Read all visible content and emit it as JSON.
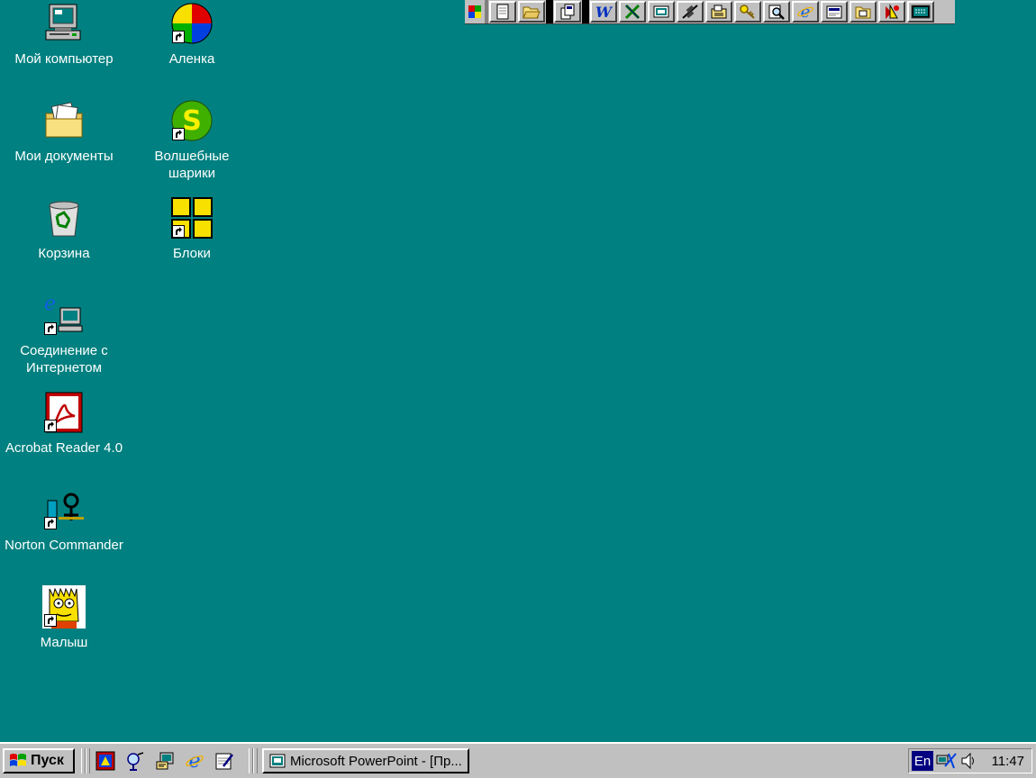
{
  "desktop": {
    "icons": [
      {
        "label": "Мой компьютер",
        "icon": "my-computer-icon"
      },
      {
        "label": "Мои документы",
        "icon": "my-documents-icon"
      },
      {
        "label": "Корзина",
        "icon": "recycle-bin-icon"
      },
      {
        "label": "Соединение с\nИнтернетом",
        "icon": "internet-connection-icon"
      },
      {
        "label": "Acrobat Reader 4.0",
        "icon": "acrobat-reader-icon"
      },
      {
        "label": "Norton Commander",
        "icon": "norton-commander-icon"
      },
      {
        "label": "Малыш",
        "icon": "malysh-icon"
      },
      {
        "label": "Аленка",
        "icon": "alenka-ball-icon"
      },
      {
        "label": "Волшебные\nшарики",
        "icon": "magic-balls-icon"
      },
      {
        "label": "Блоки",
        "icon": "blocks-icon"
      }
    ]
  },
  "office_toolbar": {
    "buttons": [
      "new-document-icon",
      "open-folder-icon",
      "binder-icon",
      "word-icon",
      "excel-icon",
      "powerpoint-icon",
      "satellite-icon",
      "contacts-icon",
      "key-icon",
      "find-icon",
      "internet-explorer-icon",
      "publisher-icon",
      "folder-icon",
      "access-icon",
      "keyboard-icon"
    ]
  },
  "taskbar": {
    "start_label": "Пуск",
    "quick_launch": [
      "powerpoint-ql-icon",
      "outlook-ql-icon",
      "desktop-ql-icon",
      "ie-ql-icon",
      "notepad-ql-icon"
    ],
    "task_label": "Microsoft PowerPoint - [Пр...",
    "tray": {
      "language": "En",
      "clock": "11:47"
    }
  },
  "colors": {
    "desktop": "#008080",
    "face": "#c0c0c0",
    "highlight": "#000080"
  }
}
